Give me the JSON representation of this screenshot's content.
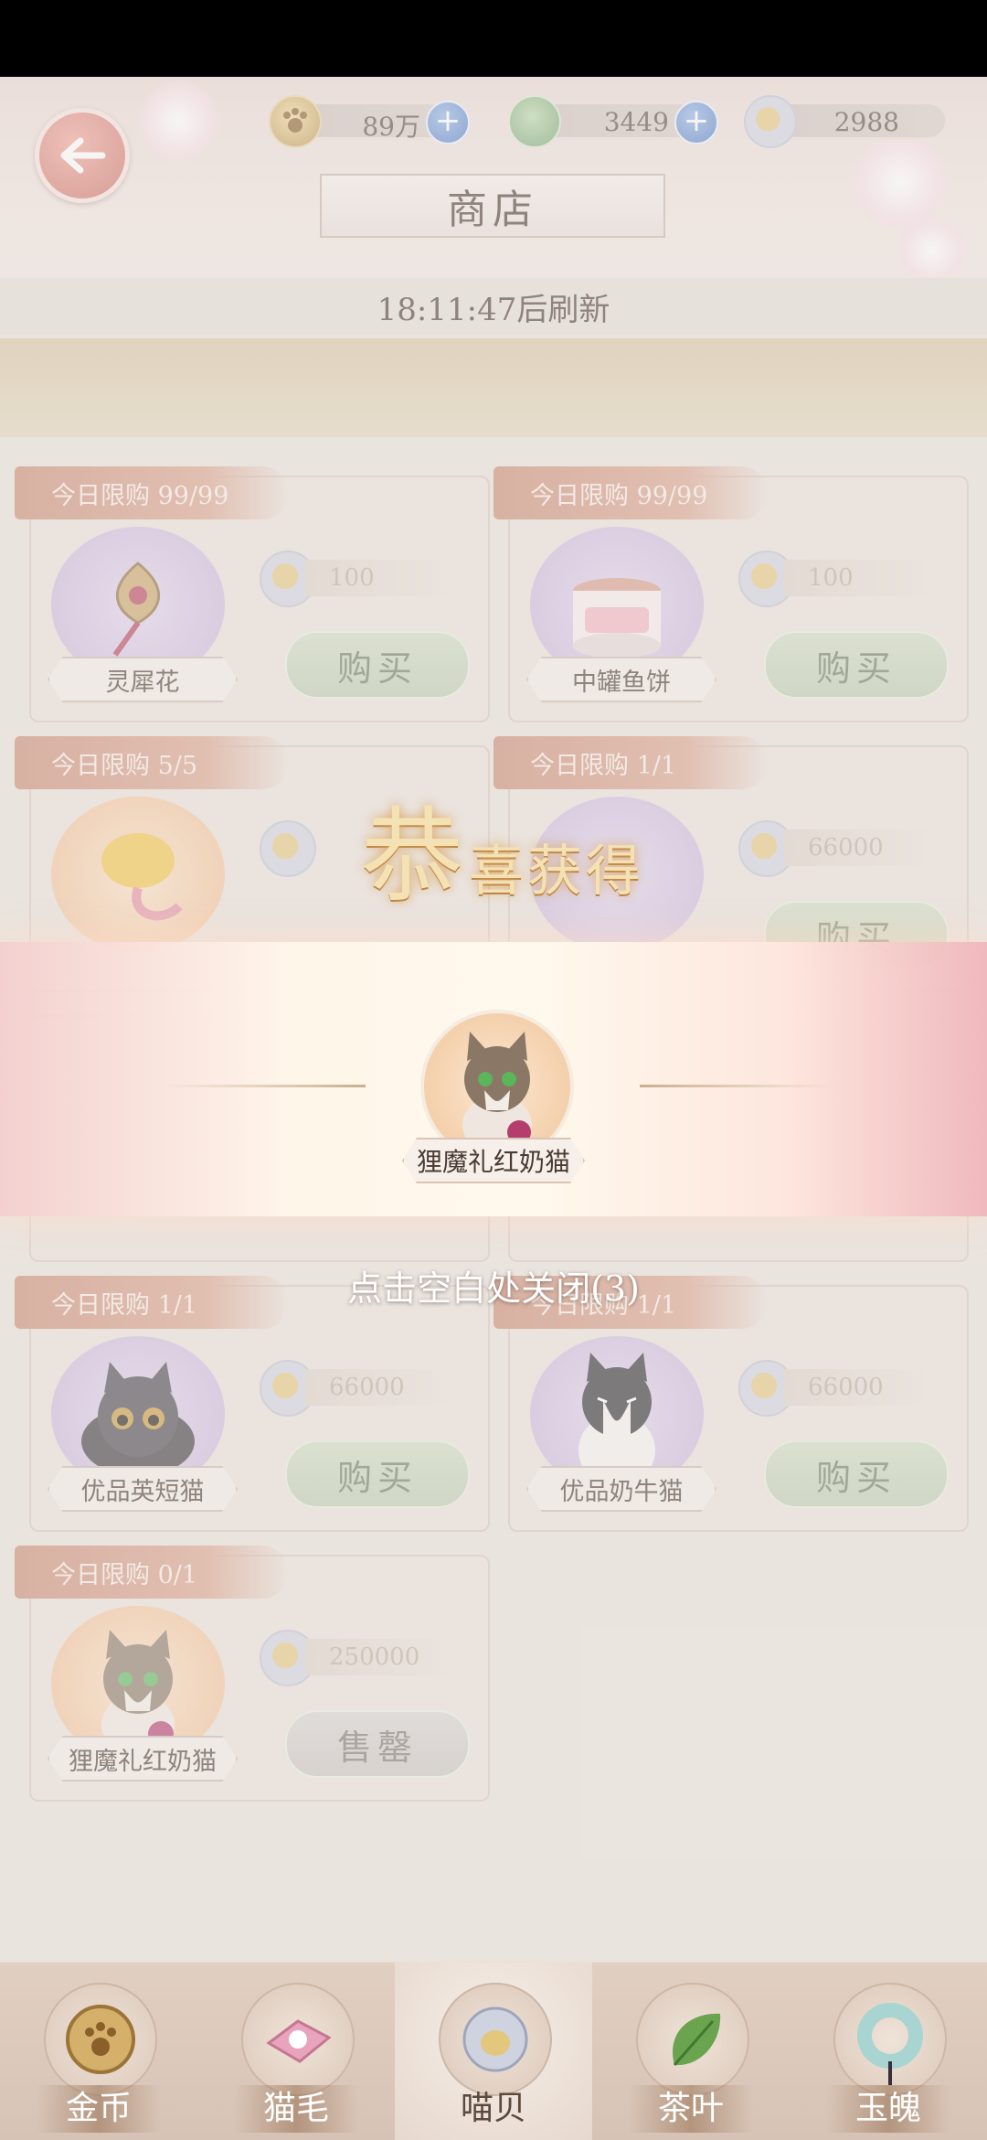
{
  "header": {
    "title": "商店",
    "refresh_text": "18:11:47后刷新",
    "currencies": [
      {
        "name": "coin",
        "value": "89万",
        "has_plus": true
      },
      {
        "name": "catnip",
        "value": "3449",
        "has_plus": true
      },
      {
        "name": "shell",
        "value": "2988",
        "has_plus": false
      }
    ]
  },
  "shop": {
    "items": [
      {
        "tag": "今日限购 99/99",
        "name": "灵犀花",
        "price": "100",
        "button": "购买",
        "portrait": "lotus-charm"
      },
      {
        "tag": "今日限购 99/99",
        "name": "中罐鱼饼",
        "price": "100",
        "button": "购买",
        "portrait": "cat-food-can"
      },
      {
        "tag": "今日限购 5/5",
        "name": "",
        "price": "",
        "button": "",
        "portrait": "golden-fish"
      },
      {
        "tag": "今日限购 1/1",
        "name": "",
        "price": "66000",
        "button": "购买",
        "portrait": "cat"
      },
      {
        "tag": "今日限购 1/1",
        "name": "优品英短猫",
        "price": "66000",
        "button": "购买",
        "portrait": "black-shorthair-cat"
      },
      {
        "tag": "今日限购 1/1",
        "name": "优品奶牛猫",
        "price": "66000",
        "button": "购买",
        "portrait": "tuxedo-cat"
      },
      {
        "tag": "今日限购 0/1",
        "name": "狸魔礼红奶猫",
        "price": "250000",
        "button": "售罄",
        "portrait": "tabby-kitten"
      }
    ]
  },
  "reward": {
    "title_big": "恭",
    "title_small": "喜获得",
    "item_name": "狸魔礼红奶猫",
    "close_hint": "点击空白处关闭(3)"
  },
  "nav": {
    "tabs": [
      {
        "label": "金币",
        "icon": "paw-coin-icon",
        "active": false
      },
      {
        "label": "猫毛",
        "icon": "cat-fur-icon",
        "active": false
      },
      {
        "label": "喵贝",
        "icon": "shell-icon",
        "active": true
      },
      {
        "label": "茶叶",
        "icon": "tea-leaf-icon",
        "active": false
      },
      {
        "label": "玉魄",
        "icon": "jade-ring-icon",
        "active": false
      }
    ]
  },
  "colors": {
    "accent": "#c98a72",
    "buy_button": "#bccbaf",
    "back_button": "#c86a5f"
  }
}
